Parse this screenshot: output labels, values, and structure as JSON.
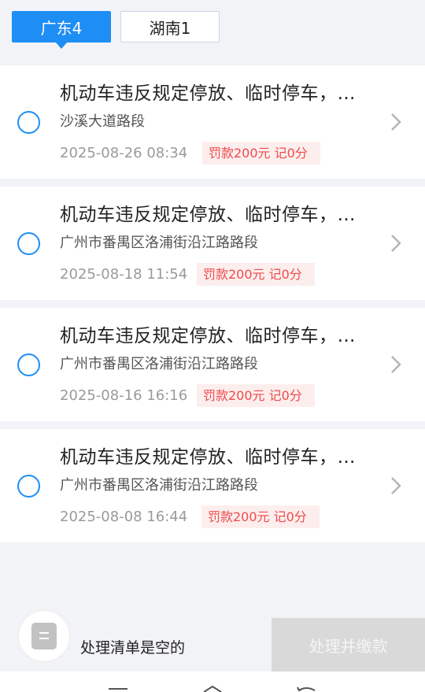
{
  "tabs": [
    {
      "label": "广东4",
      "active": true
    },
    {
      "label": "湖南1",
      "active": false
    }
  ],
  "violations": [
    {
      "title": "机动车违反规定停放、临时停车，…",
      "location": "沙溪大道路段",
      "date": "2025-08-26 08:34",
      "penalty": "罚款200元 记0分"
    },
    {
      "title": "机动车违反规定停放、临时停车，…",
      "location": "广州市番禺区洛浦街沿江路路段",
      "date": "2025-08-18 11:54",
      "penalty": "罚款200元 记0分"
    },
    {
      "title": "机动车违反规定停放、临时停车，…",
      "location": "广州市番禺区洛浦街沿江路路段",
      "date": "2025-08-16 16:16",
      "penalty": "罚款200元 记0分"
    },
    {
      "title": "机动车违反规定停放、临时停车，…",
      "location": "广州市番禺区洛浦街沿江路路段",
      "date": "2025-08-08 16:44",
      "penalty": "罚款200元 记0分"
    }
  ],
  "footer": {
    "empty_text": "处理清单是空的",
    "pay_button": "处理并缴款"
  },
  "colors": {
    "accent": "#1e8ef5",
    "penalty_text": "#ee4b4b",
    "penalty_bg": "#fdeeee",
    "disabled_button": "#d9d9d9"
  },
  "icons": [
    "radio-unchecked-icon",
    "chevron-right-icon",
    "list-icon",
    "menu-icon",
    "home-icon",
    "back-icon"
  ]
}
